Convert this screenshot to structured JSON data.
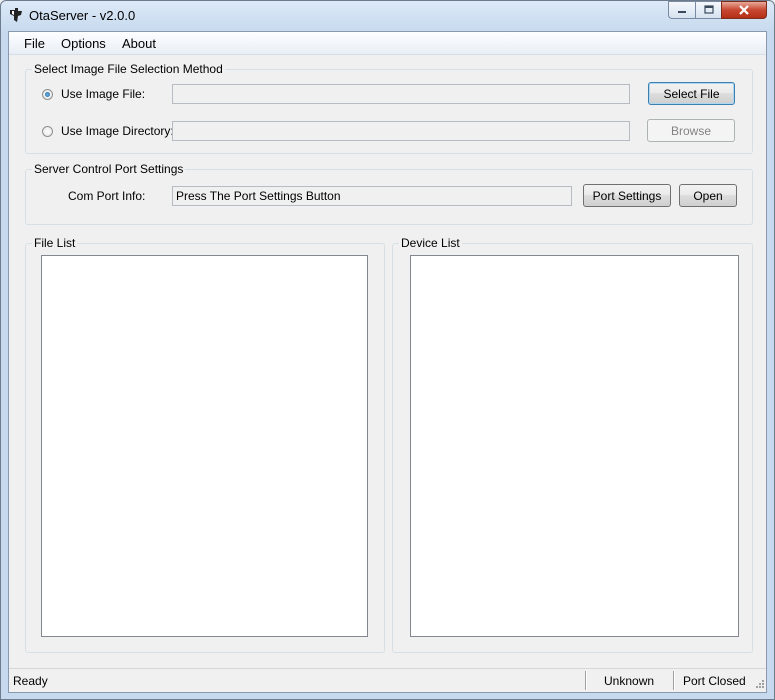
{
  "window": {
    "title": "OtaServer - v2.0.0"
  },
  "menu": {
    "file": "File",
    "options": "Options",
    "about": "About"
  },
  "image_selection": {
    "group_label": "Select Image File Selection Method",
    "use_file_label": "Use Image File:",
    "use_file_selected": true,
    "use_dir_label": "Use Image Directory:",
    "use_dir_selected": false,
    "file_path": "",
    "dir_path": "",
    "select_file_button": "Select File",
    "browse_button": "Browse"
  },
  "port_settings": {
    "group_label": "Server Control Port Settings",
    "com_port_label": "Com Port Info:",
    "com_port_value": "Press The Port Settings Button",
    "port_settings_button": "Port Settings",
    "open_button": "Open"
  },
  "file_list": {
    "label": "File List",
    "items": []
  },
  "device_list": {
    "label": "Device List",
    "items": []
  },
  "status": {
    "left": "Ready",
    "middle": "Unknown",
    "right": "Port Closed"
  },
  "icons": {
    "app": "ti-logo-icon",
    "minimize": "minimize-icon",
    "maximize": "maximize-icon",
    "close": "close-icon",
    "grip": "resize-grip-icon"
  }
}
